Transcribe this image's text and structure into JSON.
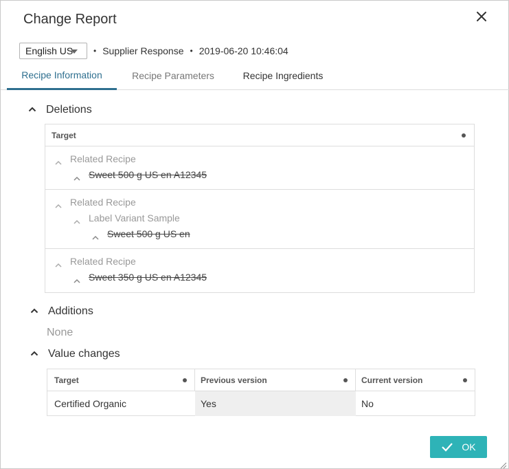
{
  "dialog": {
    "title": "Change Report",
    "close_icon": "close-icon"
  },
  "meta": {
    "language": "English US",
    "separator": "•",
    "source": "Supplier Response",
    "timestamp": "2019-06-20 10:46:04"
  },
  "tabs": [
    {
      "label": "Recipe Information",
      "active": true
    },
    {
      "label": "Recipe Parameters",
      "active": false
    },
    {
      "label": "Recipe Ingredients",
      "active": false
    }
  ],
  "deletions": {
    "title": "Deletions",
    "header": "Target",
    "rows": [
      {
        "parent": "Related Recipe",
        "item": "Sweet 500 g US en A12345"
      },
      {
        "parent": "Related Recipe",
        "sub": "Label Variant Sample",
        "item": "Sweet 500 g US en"
      },
      {
        "parent": "Related Recipe",
        "item": "Sweet 350 g US en A12345"
      }
    ]
  },
  "additions": {
    "title": "Additions",
    "none_label": "None"
  },
  "value_changes": {
    "title": "Value changes",
    "headers": [
      "Target",
      "Previous version",
      "Current version"
    ],
    "rows": [
      {
        "target": "Certified Organic",
        "previous": "Yes",
        "current": "No"
      }
    ]
  },
  "footer": {
    "ok_label": "OK"
  },
  "colors": {
    "accent": "#2e6f8f",
    "ok_button": "#2eb3b7"
  }
}
